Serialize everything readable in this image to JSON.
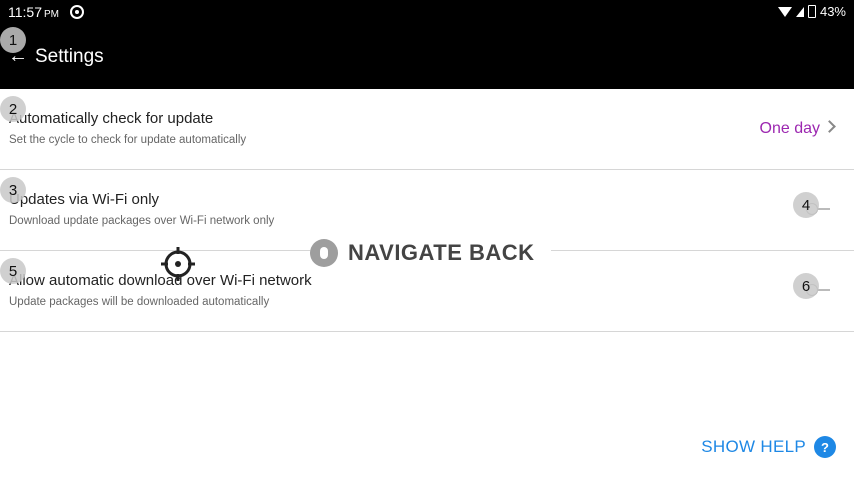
{
  "status": {
    "time": "11:57",
    "ampm": "PM",
    "battery": "43%"
  },
  "toolbar": {
    "back_icon": "arrow-left-icon",
    "title": "Settings"
  },
  "rows": [
    {
      "title": "Automatically check for update",
      "subtitle": "Set the cycle to check for update automatically",
      "value": "One day"
    },
    {
      "title": "Updates via Wi-Fi only",
      "subtitle": "Download update packages over Wi-Fi network only",
      "toggle": false
    },
    {
      "title": "Allow automatic download over Wi-Fi network",
      "subtitle": "Update packages will be downloaded automatically",
      "toggle": false
    }
  ],
  "badges": [
    "1",
    "2",
    "3",
    "4",
    "5",
    "6"
  ],
  "overlay": {
    "label": "NAVIGATE BACK",
    "icon": "microphone-icon"
  },
  "help": {
    "label": "SHOW HELP",
    "icon_text": "?"
  },
  "colors": {
    "accent_value": "#9c27b0",
    "help_blue": "#1e88e5",
    "bar_bg": "#000000"
  }
}
